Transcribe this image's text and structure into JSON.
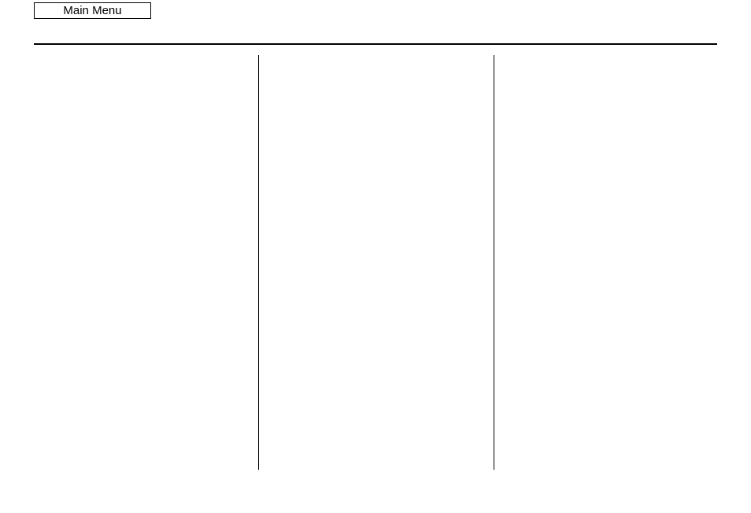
{
  "header": {
    "main_menu_label": "Main Menu"
  }
}
